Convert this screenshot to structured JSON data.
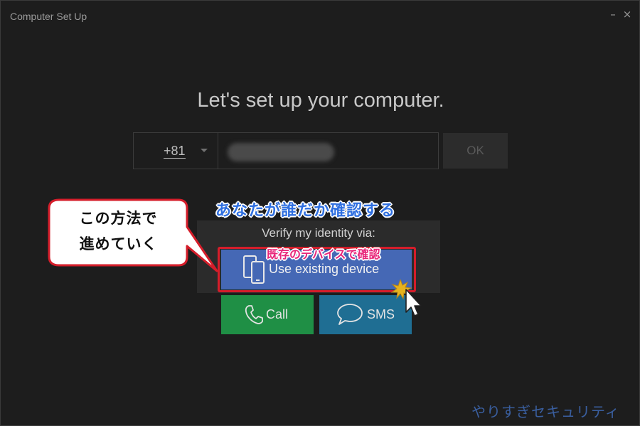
{
  "window": {
    "title": "Computer Set Up",
    "minimize_glyph": "–",
    "close_glyph": "×"
  },
  "main": {
    "heading": "Let's set up your computer.",
    "country_code": "+81",
    "phone_value": "",
    "ok_label": "OK",
    "verify_label": "Verify my identity via:",
    "options": {
      "existing_device": "Use existing device",
      "call": "Call",
      "sms": "SMS"
    }
  },
  "annotations": {
    "headline": "あなたが誰だか確認する",
    "device_note": "既存のデバイスで確認",
    "callout_line1": "この方法で",
    "callout_line2": "進めていく",
    "watermark": "やりすぎセキュリティ"
  },
  "colors": {
    "background": "#1d1d1d",
    "device_button": "#4568b5",
    "call_button": "#1f8f45",
    "sms_button": "#1f6e93",
    "highlight_red": "#d51d2a",
    "annotation_blue": "#2f6fe0",
    "annotation_pink": "#e8267a"
  },
  "icons": [
    "minimize-icon",
    "close-icon",
    "chevron-down-icon",
    "mobile-devices-icon",
    "phone-icon",
    "chat-bubble-icon",
    "mouse-cursor-icon"
  ]
}
